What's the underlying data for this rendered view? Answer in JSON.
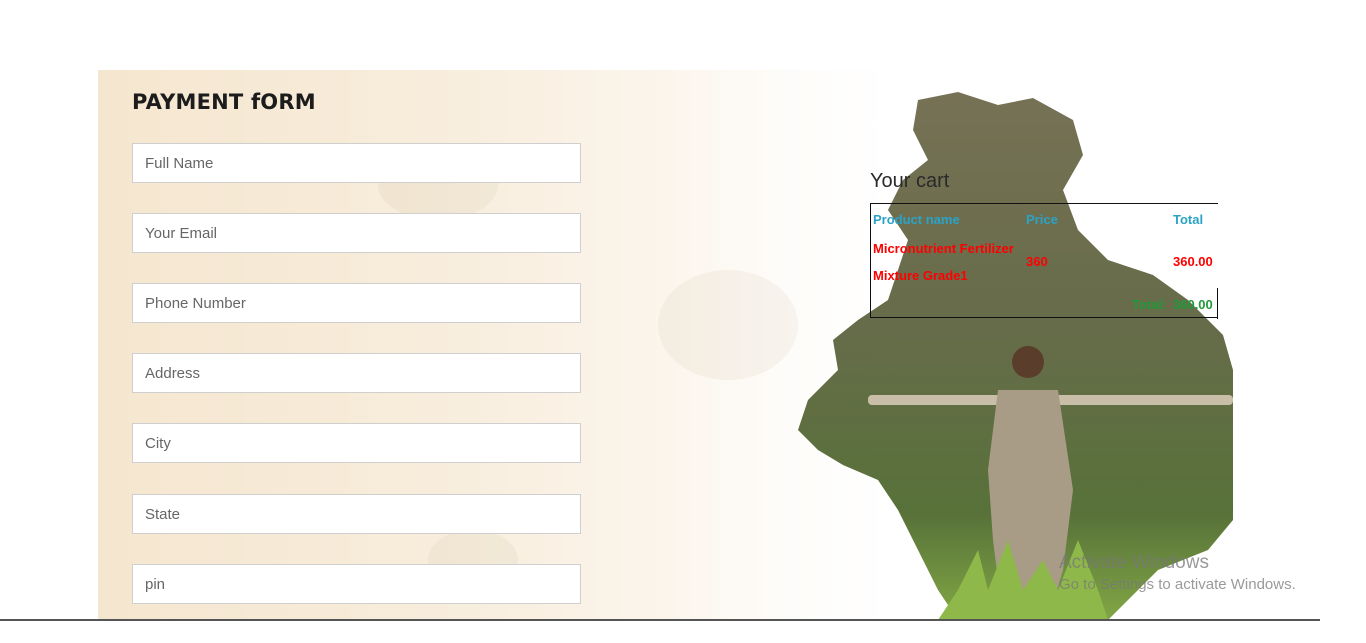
{
  "form": {
    "title": "PAYMENT fORM",
    "fields": [
      {
        "placeholder": "Full Name"
      },
      {
        "placeholder": "Your Email"
      },
      {
        "placeholder": "Phone Number"
      },
      {
        "placeholder": "Address"
      },
      {
        "placeholder": "City"
      },
      {
        "placeholder": "State"
      },
      {
        "placeholder": "pin"
      }
    ]
  },
  "cart": {
    "title": "Your cart",
    "headers": {
      "product": "Product name",
      "price": "Price",
      "total": "Total"
    },
    "items": [
      {
        "name_line1": "Micronutrient Fertilizer",
        "name_line2": "Mixture Grade1",
        "price": "360",
        "total": "360.00"
      }
    ],
    "total_label": "Total:",
    "total_value": "360.00"
  },
  "watermark": {
    "line1": "Activate Windows",
    "line2": "Go to Settings to activate Windows."
  },
  "colors": {
    "header": "#2aa3c7",
    "item": "#ff0000",
    "total": "#1f9a3a"
  }
}
